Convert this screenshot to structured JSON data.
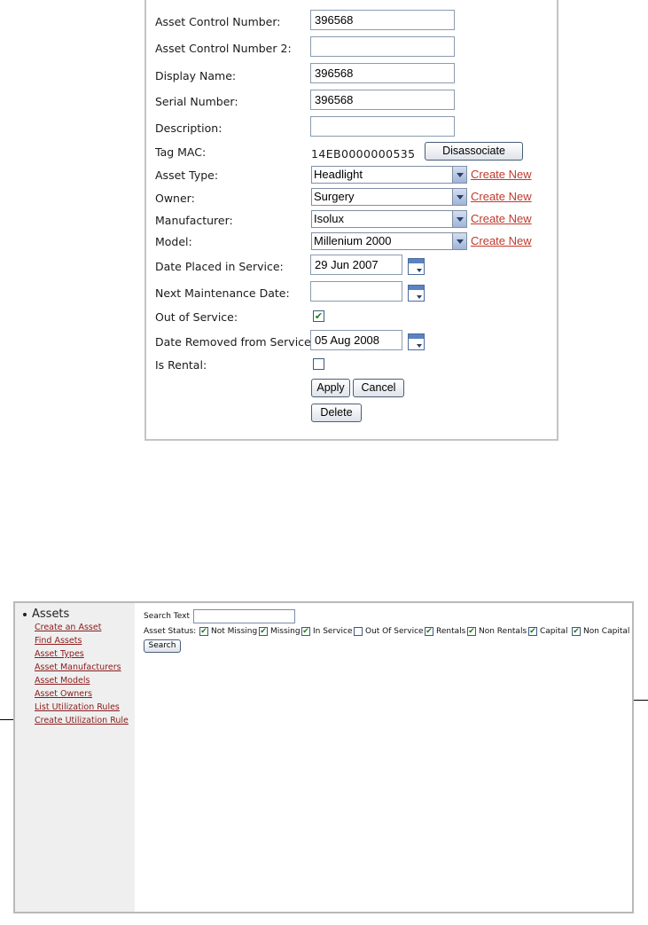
{
  "form": {
    "asset_control_number": {
      "label": "Asset Control Number:",
      "value": "396568"
    },
    "asset_control_number_2": {
      "label": "Asset Control Number 2:",
      "value": ""
    },
    "display_name": {
      "label": "Display Name:",
      "value": "396568"
    },
    "serial_number": {
      "label": "Serial Number:",
      "value": "396568"
    },
    "description": {
      "label": "Description:",
      "value": ""
    },
    "tag_mac": {
      "label": "Tag MAC:",
      "value": "14EB0000000535",
      "button": "Disassociate"
    },
    "asset_type": {
      "label": "Asset Type:",
      "value": "Headlight",
      "link": "Create New"
    },
    "owner": {
      "label": "Owner:",
      "value": "Surgery",
      "link": "Create New"
    },
    "manufacturer": {
      "label": "Manufacturer:",
      "value": "Isolux",
      "link": "Create New"
    },
    "model": {
      "label": "Model:",
      "value": "Millenium 2000",
      "link": "Create New"
    },
    "date_placed": {
      "label": "Date Placed in Service:",
      "value": "29 Jun 2007"
    },
    "next_maintenance": {
      "label": "Next Maintenance Date:",
      "value": ""
    },
    "out_of_service": {
      "label": "Out of Service:",
      "checked": true
    },
    "date_removed": {
      "label": "Date Removed from Service:",
      "value": "05 Aug 2008"
    },
    "is_rental": {
      "label": "Is Rental:",
      "checked": false
    },
    "apply_label": "Apply",
    "cancel_label": "Cancel",
    "delete_label": "Delete"
  },
  "search": {
    "sidebar": {
      "heading": "Assets",
      "links": [
        "Create an Asset",
        "Find Assets",
        "Asset Types",
        "Asset Manufacturers",
        "Asset Models",
        "Asset Owners",
        "List Utilization Rules",
        "Create Utilization Rule"
      ]
    },
    "search_text_label": "Search Text",
    "search_text_value": "",
    "status_label": "Asset Status:",
    "filters": [
      {
        "label": "Not Missing",
        "checked": true
      },
      {
        "label": "Missing",
        "checked": true
      },
      {
        "label": "In Service",
        "checked": true
      },
      {
        "label": "Out Of Service",
        "checked": false
      },
      {
        "label": "Rentals",
        "checked": true
      },
      {
        "label": "Non Rentals",
        "checked": true
      },
      {
        "label": "Capital",
        "checked": true
      },
      {
        "label": "Non Capital",
        "checked": true
      }
    ],
    "search_button": "Search"
  },
  "colors": {
    "create_new_link": "#c0392b",
    "sidebar_link": "#8b1a1a",
    "sidebar_bg": "#efefef",
    "check_mark": "#1c7c1c"
  }
}
